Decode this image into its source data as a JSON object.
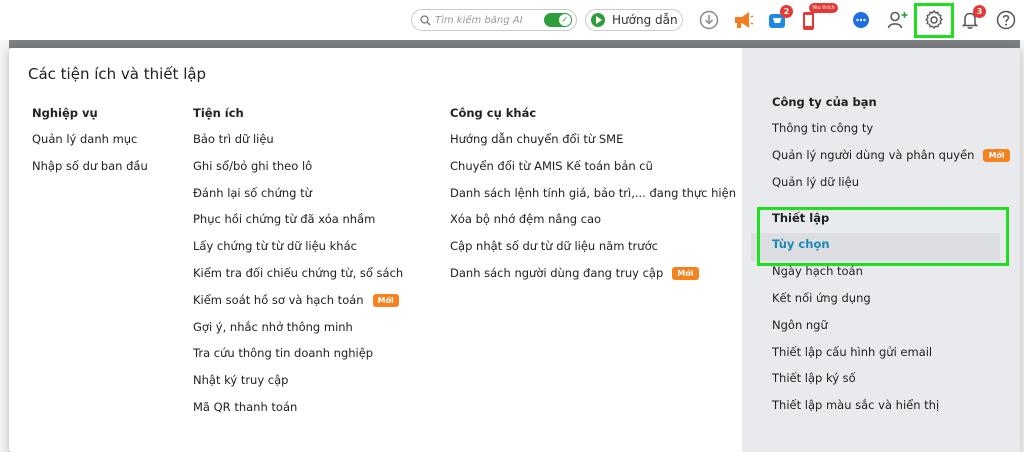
{
  "topbar": {
    "search_placeholder": "Tìm kiếm bằng AI",
    "guide_label": "Hướng dẫn",
    "cart_badge": "2",
    "wish_badge": "Yêu thích",
    "notification_badge": "3"
  },
  "popup": {
    "title": "Các tiện ích và thiết lập",
    "new_tag": "Mới",
    "columns": [
      {
        "heading": "Nghiệp vụ",
        "items": [
          "Quản lý danh mục",
          "Nhập số dư ban đầu"
        ]
      },
      {
        "heading": "Tiện ích",
        "items": [
          "Bảo trì dữ liệu",
          "Ghi sổ/bỏ ghi theo lô",
          "Đánh lại số chứng từ",
          "Phục hồi chứng từ đã xóa nhầm",
          "Lấy chứng từ từ dữ liệu khác",
          "Kiểm tra đối chiếu chứng từ, sổ sách",
          "Kiểm soát hồ sơ và hạch toán",
          "Gợi ý, nhắc nhở thông minh",
          "Tra cứu thông tin doanh nghiệp",
          "Nhật ký truy cập",
          "Mã QR thanh toán"
        ]
      },
      {
        "heading": "Công cụ khác",
        "items": [
          "Hướng dẫn chuyển đổi từ SME",
          "Chuyển đổi từ AMIS Kế toán bản cũ",
          "Danh sách lệnh tính giá, bảo trì,... đang thực hiện",
          "Xóa bộ nhớ đệm nâng cao",
          "Cập nhật số dư từ dữ liệu năm trước",
          "Danh sách người dùng đang truy cập"
        ]
      }
    ],
    "side": {
      "company_heading": "Công ty của bạn",
      "company_items": [
        "Thông tin công ty",
        "Quản lý người dùng và phân quyền",
        "Quản lý dữ liệu"
      ],
      "settings_heading": "Thiết lập",
      "settings_items": [
        "Tùy chọn",
        "Ngày hạch toán",
        "Kết nối ứng dụng",
        "Ngôn ngữ",
        "Thiết lập cấu hình gửi email",
        "Thiết lập ký số",
        "Thiết lập màu sắc và hiển thị"
      ]
    }
  },
  "colors": {
    "highlight": "#1fe01f",
    "accent_green": "#2e9e3c",
    "new_tag": "#f5821f",
    "active_link": "#1b88b6",
    "badge": "#e53935"
  }
}
